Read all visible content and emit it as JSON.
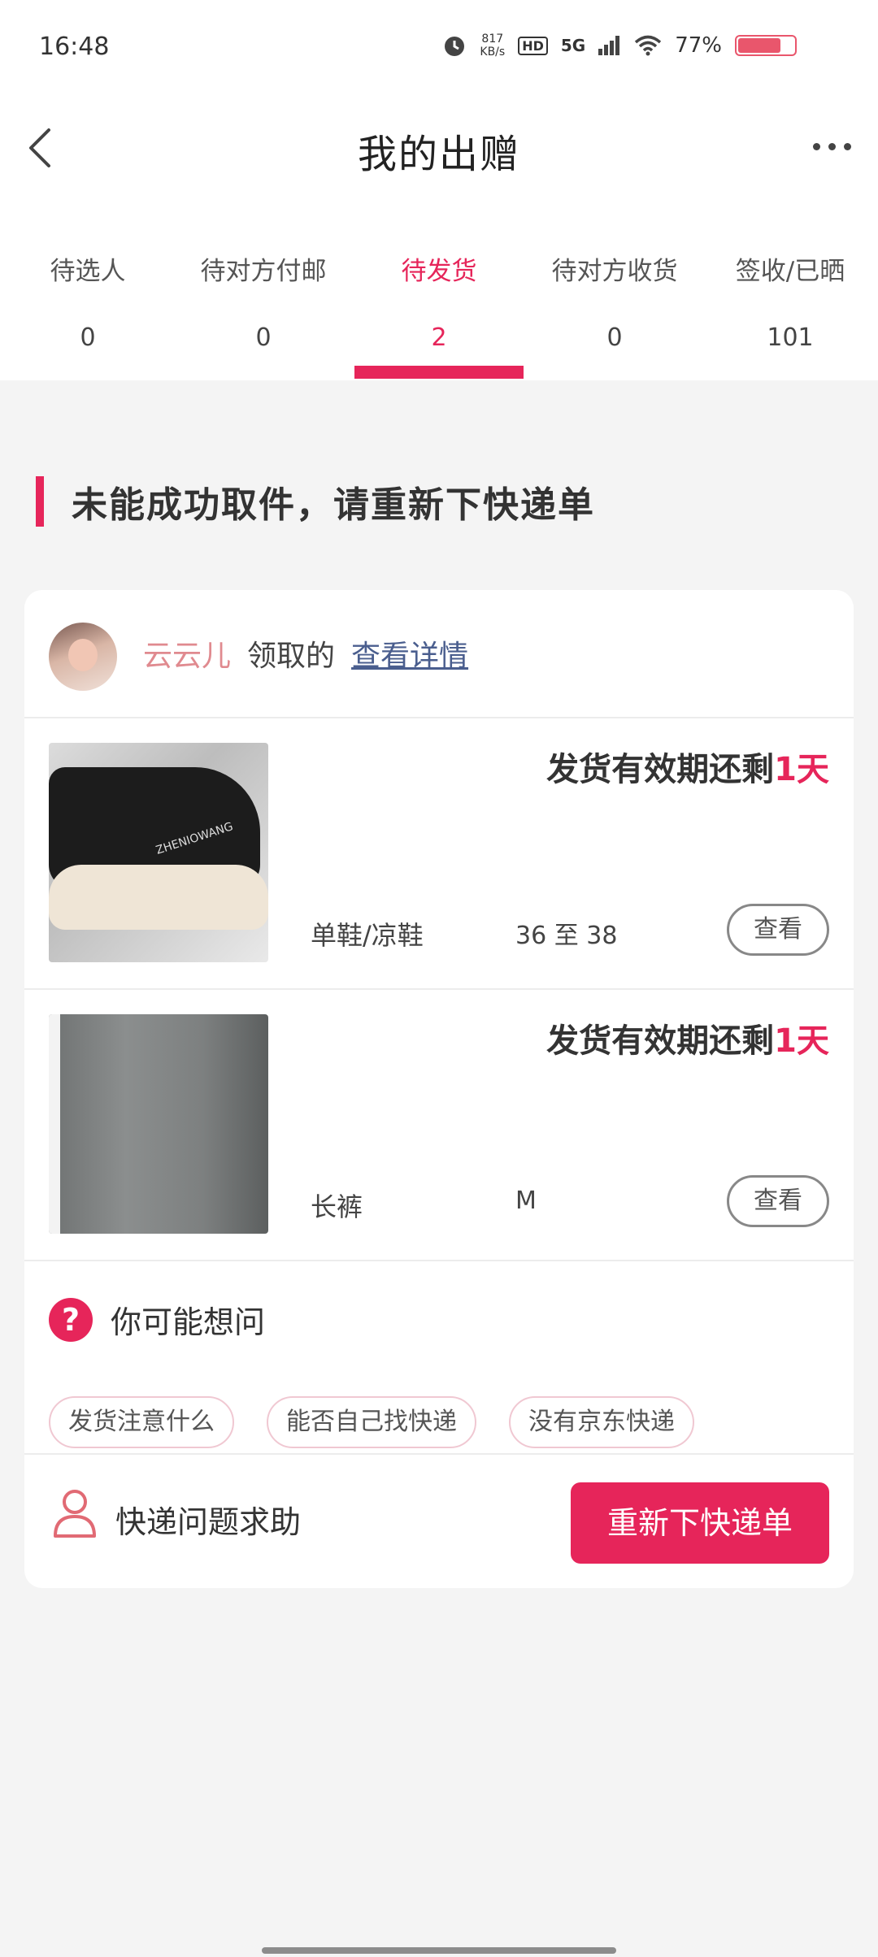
{
  "status_bar": {
    "time": "16:48",
    "net_speed_value": "817",
    "net_speed_unit": "KB/s",
    "hd": "HD",
    "network": "5G",
    "battery_percent": "77%",
    "battery_level": 0.77,
    "icons": [
      "alarm-icon",
      "hd-icon",
      "signal-icon",
      "wifi-icon",
      "battery-icon"
    ]
  },
  "header": {
    "title": "我的出赠",
    "icons": [
      "back-arrow-icon",
      "more-dots-icon"
    ]
  },
  "tabs": [
    {
      "label": "待选人",
      "count": "0"
    },
    {
      "label": "待对方付邮",
      "count": "0"
    },
    {
      "label": "待发货",
      "count": "2",
      "active": true
    },
    {
      "label": "待对方收货",
      "count": "0"
    },
    {
      "label": "签收/已晒",
      "count": "101"
    }
  ],
  "notice": {
    "text": "未能成功取件，请重新下快递单"
  },
  "order": {
    "receiver_name": "云云儿",
    "receiver_verb": "领取的",
    "detail_link": "查看详情",
    "items": [
      {
        "deadline_prefix": "发货有效期还剩",
        "deadline_days": "1天",
        "category": "单鞋/凉鞋",
        "size": "36 至 38",
        "view_label": "查看",
        "image": "shoe-photo",
        "brand_text": "ZHENIOWANG"
      },
      {
        "deadline_prefix": "发货有效期还剩",
        "deadline_days": "1天",
        "category": "长裤",
        "size": "M",
        "view_label": "查看",
        "image": "pants-photo"
      }
    ],
    "faq": {
      "title": "你可能想问",
      "icon": "question-icon",
      "chips": [
        "发货注意什么",
        "能否自己找快递",
        "没有京东快递"
      ]
    },
    "help": {
      "label": "快递问题求助",
      "icon": "user-icon",
      "button": "重新下快递单"
    }
  },
  "colors": {
    "accent": "#e6255a",
    "receiver_name": "#e08a8f",
    "link": "#4a5e8e",
    "page_bg": "#f4f4f4"
  }
}
